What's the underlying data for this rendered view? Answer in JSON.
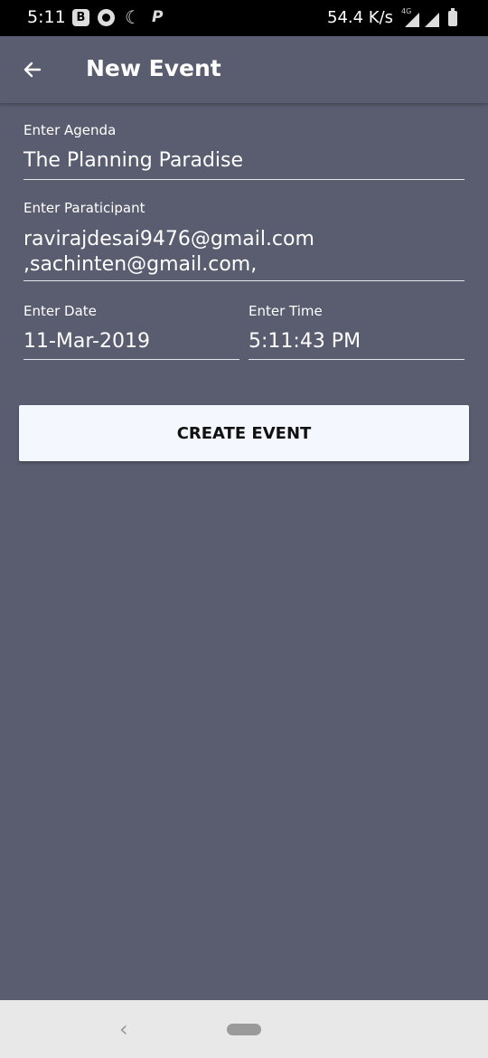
{
  "status_bar": {
    "time": "5:11",
    "notif_b": "B",
    "notif_p": "P",
    "net_speed": "54.4 K/s",
    "network": "4G"
  },
  "app_bar": {
    "back_icon": "arrow-left-icon",
    "title": "New Event"
  },
  "form": {
    "agenda": {
      "label": "Enter Agenda",
      "value": "The Planning Paradise"
    },
    "participant": {
      "label": "Enter Paraticipant",
      "value": "ravirajdesai9476@gmail.com\n,sachinten@gmail.com,"
    },
    "date": {
      "label": "Enter Date",
      "value": "11-Mar-2019"
    },
    "time": {
      "label": "Enter Time",
      "value": "5:11:43 PM"
    }
  },
  "actions": {
    "create_label": "CREATE EVENT"
  },
  "colors": {
    "background": "#5a5c70",
    "button_bg": "#f4f7fd",
    "underline": "#e6e6ea"
  }
}
